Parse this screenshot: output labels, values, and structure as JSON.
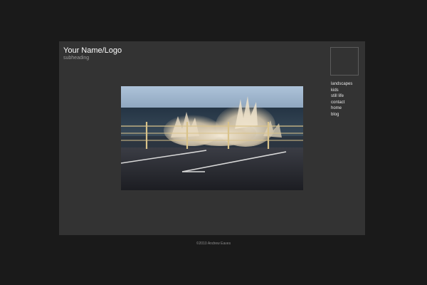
{
  "header": {
    "title": "Your Name/Logo",
    "subheading": "subheading"
  },
  "nav": {
    "items": [
      {
        "label": "landscapes"
      },
      {
        "label": "kids"
      },
      {
        "label": "still life"
      },
      {
        "label": "contact"
      },
      {
        "label": "home"
      },
      {
        "label": "blog"
      }
    ]
  },
  "footer": {
    "copyright": "©2010 Andrew Eaves"
  },
  "colors": {
    "page_background": "#1a1a1a",
    "panel_background": "#333333",
    "title_text": "#ffffff",
    "subheading_text": "#9a9a9a",
    "nav_text": "#e6e6e6"
  }
}
